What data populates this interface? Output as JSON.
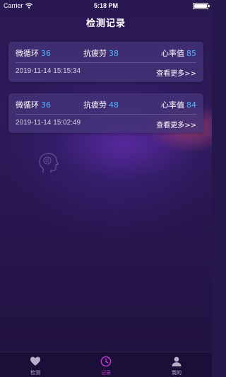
{
  "status_bar": {
    "carrier": "Carrier",
    "time": "5:18 PM"
  },
  "nav": {
    "title": "检测记录"
  },
  "records": [
    {
      "micro_label": "微循环",
      "micro_value": "36",
      "fatigue_label": "抗疲劳",
      "fatigue_value": "38",
      "heart_label": "心率值",
      "heart_value": "85",
      "timestamp": "2019-11-14 15:15:34",
      "more_label": "查看更多>>"
    },
    {
      "micro_label": "微循环",
      "micro_value": "36",
      "fatigue_label": "抗疲劳",
      "fatigue_value": "48",
      "heart_label": "心率值",
      "heart_value": "84",
      "timestamp": "2019-11-14 15:02:49",
      "more_label": "查看更多>>"
    }
  ],
  "tabbar": {
    "active_color": "#c63ad6",
    "items": [
      {
        "label": "检测",
        "icon": "heart-icon"
      },
      {
        "label": "记录",
        "icon": "clock-icon"
      },
      {
        "label": "我的",
        "icon": "user-icon"
      }
    ]
  }
}
